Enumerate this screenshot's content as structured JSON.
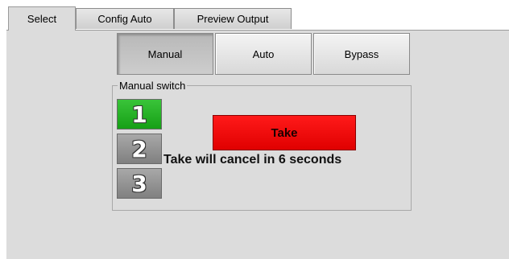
{
  "tabs": [
    {
      "label": "Select",
      "active": true
    },
    {
      "label": "Config Auto",
      "active": false
    },
    {
      "label": "Preview Output",
      "active": false
    }
  ],
  "modes": [
    {
      "label": "Manual",
      "selected": true
    },
    {
      "label": "Auto",
      "selected": false
    },
    {
      "label": "Bypass",
      "selected": false
    }
  ],
  "manual_switch": {
    "legend": "Manual switch",
    "inputs": [
      {
        "label": "1",
        "selected": true
      },
      {
        "label": "2",
        "selected": false
      },
      {
        "label": "3",
        "selected": false
      }
    ],
    "take_label": "Take",
    "take_message": "Take will cancel in 6 seconds"
  },
  "colors": {
    "selected_input": "#22b022",
    "take_button": "#ff0000",
    "panel_background": "#dcdcdc"
  }
}
